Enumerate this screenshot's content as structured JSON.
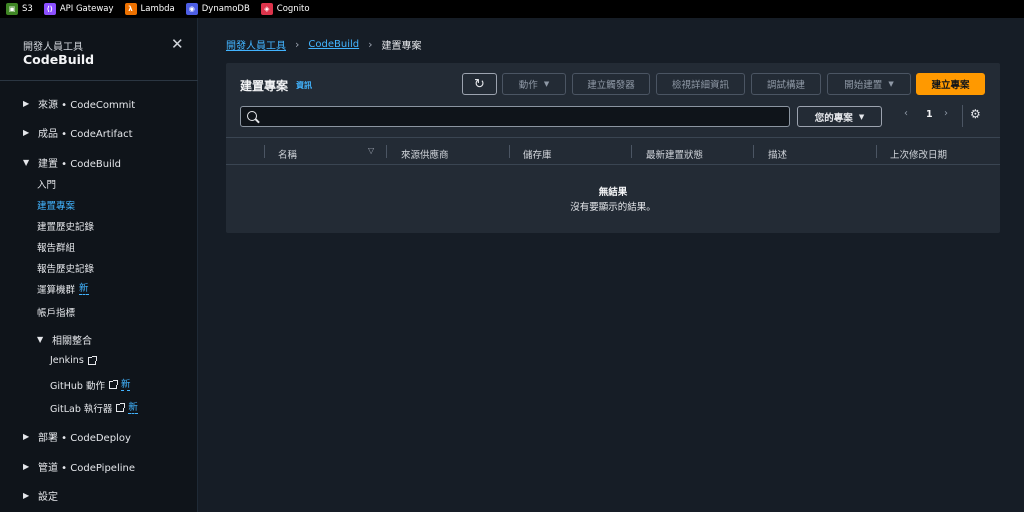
{
  "favorites": [
    {
      "label": "S3",
      "icon": "s3-icon",
      "color": "#3f8624"
    },
    {
      "label": "API Gateway",
      "icon": "api-gateway-icon",
      "color": "#8c4fff"
    },
    {
      "label": "Lambda",
      "icon": "lambda-icon",
      "color": "#ed7100"
    },
    {
      "label": "DynamoDB",
      "icon": "dynamodb-icon",
      "color": "#4d5ee5"
    },
    {
      "label": "Cognito",
      "icon": "cognito-icon",
      "color": "#dd344c"
    }
  ],
  "sidebar": {
    "subtitle": "開發人員工具",
    "title": "CodeBuild",
    "sections": {
      "source": "來源 • CodeCommit",
      "artifacts": "成品 • CodeArtifact",
      "build": "建置 • CodeBuild",
      "deploy": "部署 • CodeDeploy",
      "pipeline": "管道 • CodePipeline",
      "settings": "設定"
    },
    "build_items": {
      "getting_started": "入門",
      "build_projects": "建置專案",
      "build_history": "建置歷史記錄",
      "report_groups": "報告群組",
      "report_history": "報告歷史記錄",
      "compute_fleets": "運算機群",
      "account_metrics": "帳戶指標"
    },
    "integrations": {
      "label": "相關整合",
      "jenkins": "Jenkins",
      "github": "GitHub 動作",
      "gitlab": "GitLab 執行器"
    },
    "new_badge": "新"
  },
  "breadcrumb": {
    "root": "開發人員工具",
    "service": "CodeBuild",
    "current": "建置專案"
  },
  "panel": {
    "title": "建置專案",
    "info": "資訊",
    "buttons": {
      "actions": "動作",
      "create_trigger": "建立觸發器",
      "view_details": "檢視詳細資訊",
      "debug_build": "調試構建",
      "start_build": "開始建置",
      "create_project": "建立專案"
    },
    "search_placeholder": "",
    "filter_dropdown": "您的專案",
    "page": "1",
    "columns": [
      "名稱",
      "來源供應商",
      "儲存庫",
      "最新建置狀態",
      "描述",
      "上次修改日期"
    ],
    "empty_title": "無結果",
    "empty_desc": "沒有要顯示的結果。"
  },
  "colors": {
    "accent": "#42b4ff",
    "primary_button": "#ff9900"
  }
}
